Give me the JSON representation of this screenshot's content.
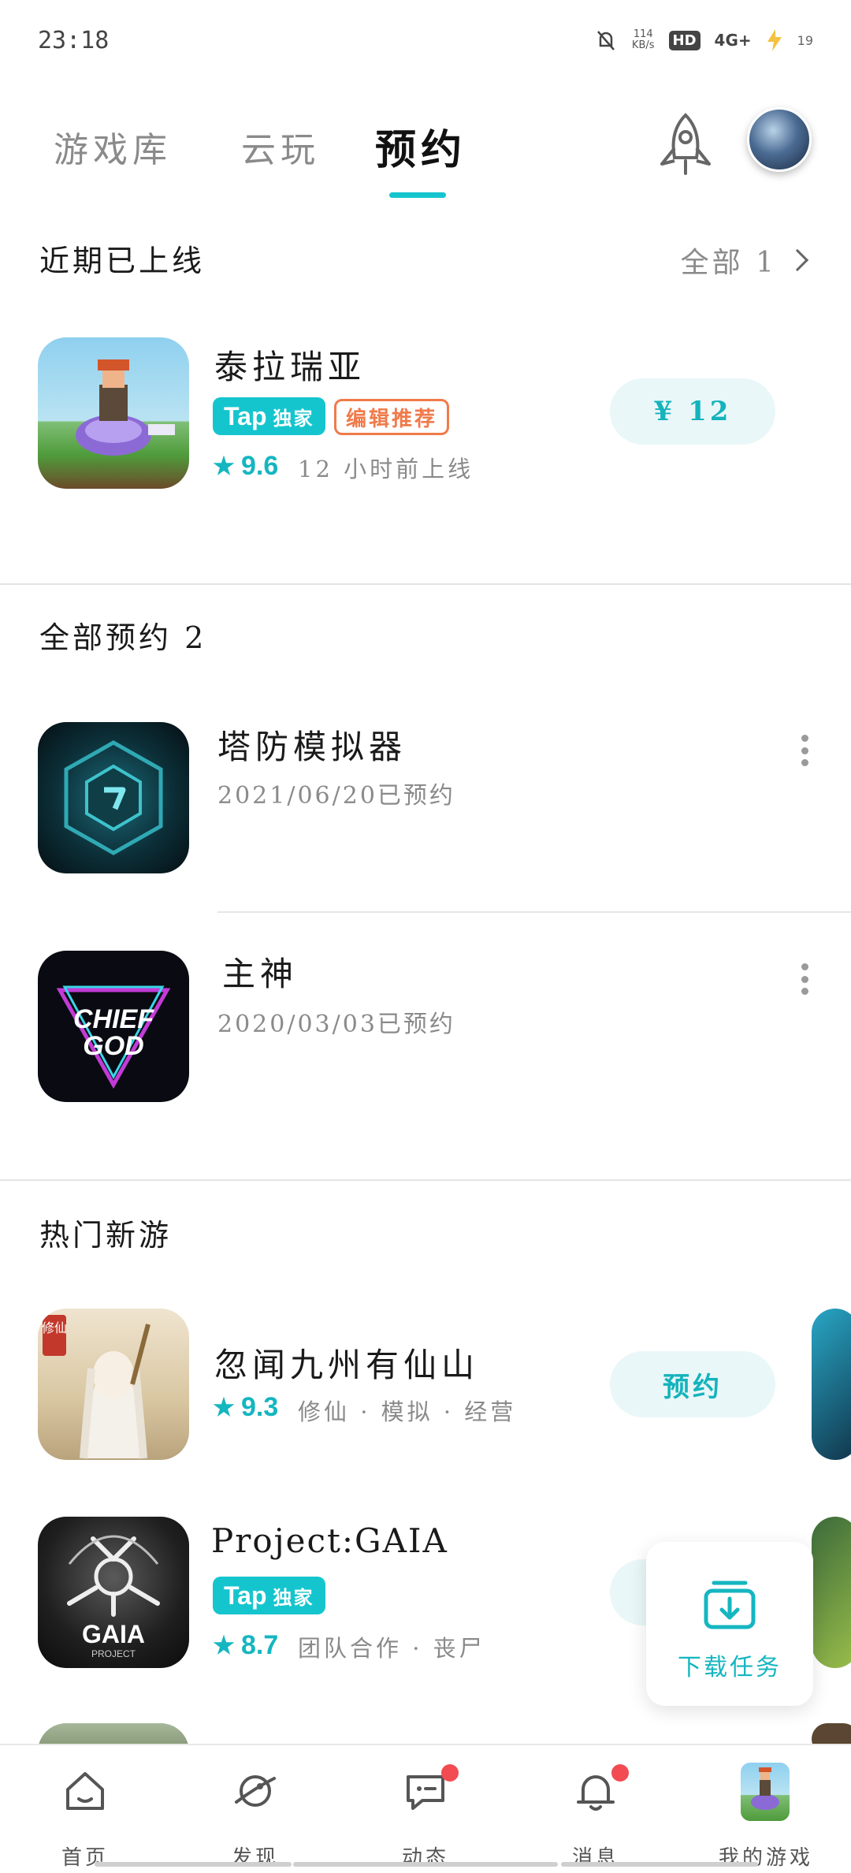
{
  "status": {
    "time": "23:18",
    "speed_top": "114",
    "speed_bottom": "KB/s",
    "hd": "HD",
    "net": "4G+",
    "battery": "19"
  },
  "tabs": {
    "library": "游戏库",
    "cloud": "云玩",
    "reserve": "预约"
  },
  "recent": {
    "title": "近期已上线",
    "all_label": "全部 1",
    "game": {
      "name": "泰拉瑞亚",
      "badge_tap": "Tap",
      "badge_tap_text": "独家",
      "badge_editor": "编辑推荐",
      "rating": "9.6",
      "meta": "12 小时前上线",
      "price": "¥ 12"
    }
  },
  "reservations": {
    "title": "全部预约 2",
    "items": [
      {
        "name": "塔防模拟器",
        "date": "2021/06/20已预约"
      },
      {
        "name": "主神",
        "date": "2020/03/03已预约"
      }
    ]
  },
  "hot": {
    "title": "热门新游",
    "items": [
      {
        "name": "忽闻九州有仙山",
        "rating": "9.3",
        "tags": "修仙 · 模拟 · 经营",
        "button": "预约",
        "icon_tag": "修仙"
      },
      {
        "name": "Project:GAIA",
        "badge_tap": "Tap",
        "badge_tap_text": "独家",
        "rating": "8.7",
        "tags": "团队合作 · 丧尸",
        "icon_word": "GAIA",
        "icon_sub": "PROJECT"
      }
    ]
  },
  "chief_icon": {
    "line1": "CHIEF",
    "line2": "GOD"
  },
  "download_tasks": {
    "label": "下载任务"
  },
  "bottom_nav": [
    {
      "label": "首页"
    },
    {
      "label": "发现"
    },
    {
      "label": "动态"
    },
    {
      "label": "消息"
    },
    {
      "label": "我的游戏"
    }
  ],
  "colors": {
    "accent": "#15c5ce",
    "badge_orange": "#f07a4a",
    "notification": "#f24b52"
  }
}
